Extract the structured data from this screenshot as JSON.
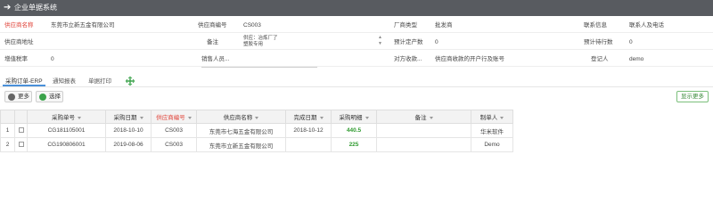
{
  "header": {
    "back_icon": "arrow-left-icon",
    "title": "企业单据系统"
  },
  "form": {
    "supplier_name": {
      "label": "供应商名称",
      "value": "东莞市立新五金有限公司"
    },
    "supplier_code": {
      "label": "供应商编号",
      "value": "CS003"
    },
    "factory_type": {
      "label": "厂商类型",
      "value": "批发商"
    },
    "contact_info": {
      "label": "联系信息",
      "value": "联系人及电话"
    },
    "supplier_address": {
      "label": "供应商地址",
      "value": ""
    },
    "remark": {
      "label": "备注",
      "value_line1": "供应：冶炼厂了",
      "value_line2": "塑胶专用"
    },
    "paid_count": {
      "label": "预计定产数",
      "value": "0"
    },
    "unpaid_count": {
      "label": "预计待行数",
      "value": "0"
    },
    "tax_rate": {
      "label": "增值税率",
      "value": "0"
    },
    "sales_person": {
      "label": "销售人员...",
      "value": ""
    },
    "payment": {
      "label": "对方收款...",
      "value": "供应商收款的开户行及账号"
    },
    "register": {
      "label": "登记人",
      "value": "demo"
    }
  },
  "tabs": [
    {
      "label": "采购订单-ERP"
    },
    {
      "label": "通知报表"
    },
    {
      "label": "单据打印"
    }
  ],
  "toolbar": {
    "more_label": "更多",
    "select_label": "选择",
    "show_more_label": "显示更多"
  },
  "table": {
    "columns": [
      "",
      "",
      "采购单号",
      "采购日期",
      "供应商编号",
      "供应商名称",
      "完成日期",
      "采购明细",
      "备注",
      "制单人"
    ],
    "rows": [
      {
        "num": "1",
        "order_no": "CG181105001",
        "date": "2018-10-10",
        "supplier_code": "CS003",
        "supplier_name": "东莞市七海五金有限公司",
        "complete_date": "2018-10-12",
        "detail": "440.5",
        "remark": "",
        "creator": "华米软件"
      },
      {
        "num": "2",
        "order_no": "CG190806001",
        "date": "2019-08-06",
        "supplier_code": "CS003",
        "supplier_name": "东莞市立新五金有限公司",
        "complete_date": "",
        "detail": "225",
        "remark": "",
        "creator": "Demo"
      }
    ]
  },
  "colors": {
    "topbar": "#585b60",
    "required": "#e0443a",
    "green_value": "#2e9a2e",
    "accent": "#4a90d9"
  }
}
